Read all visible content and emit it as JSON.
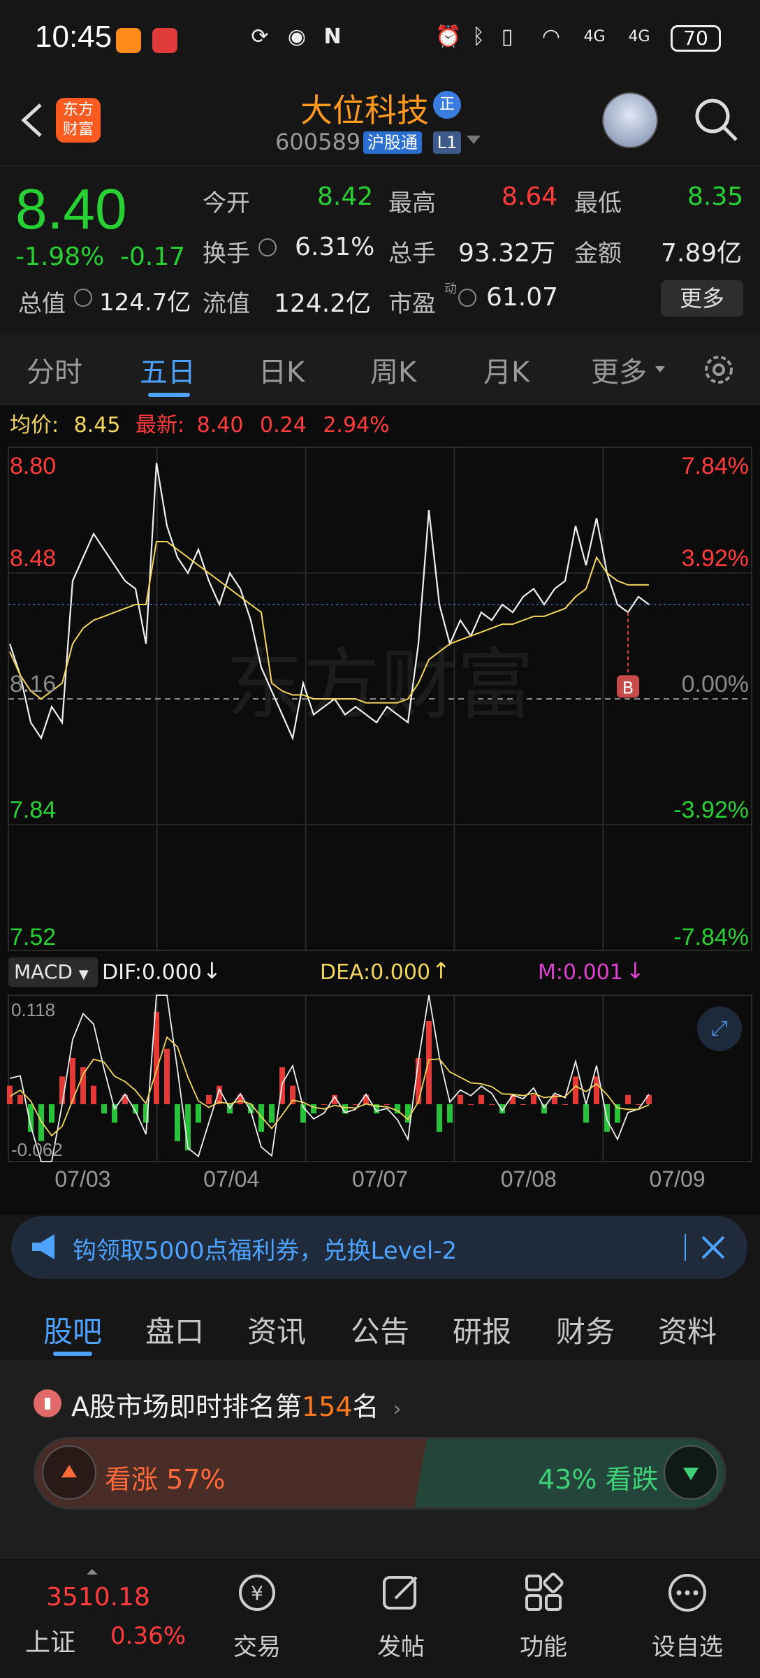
{
  "status": {
    "time": "10:45",
    "battery": "70",
    "net1": "4G",
    "net2": "4G"
  },
  "header": {
    "title": "大位科技",
    "title_badge": "正",
    "code": "600589",
    "market_badge": "沪股通",
    "level_badge": "L1",
    "logo_line1": "东方",
    "logo_line2": "财富"
  },
  "quote": {
    "price": "8.40",
    "change_pct": "-1.98%",
    "change": "-0.17",
    "open_label": "今开",
    "open": "8.42",
    "high_label": "最高",
    "high": "8.64",
    "low_label": "最低",
    "low": "8.35",
    "turnover_label": "换手",
    "turnover": "6.31%",
    "volume_label": "总手",
    "volume": "93.32万",
    "amount_label": "金额",
    "amount": "7.89亿",
    "mcap_label": "总值",
    "mcap": "124.7亿",
    "float_label": "流值",
    "float": "124.2亿",
    "pe_label": "市盈",
    "pe_sup": "动",
    "pe": "61.07",
    "more_button": "更多"
  },
  "tabs": [
    "分时",
    "五日",
    "日K",
    "周K",
    "月K",
    "更多"
  ],
  "active_tab": 1,
  "avg_line": {
    "avg_label": "均价:",
    "avg": "8.45",
    "last_label": "最新:",
    "last": "8.40",
    "chg": "0.24",
    "pct": "2.94%"
  },
  "chart_data": {
    "type": "line",
    "title": "",
    "x_labels": [
      "07/03",
      "07/04",
      "07/07",
      "07/08",
      "07/09"
    ],
    "y_left_ticks": [
      "8.80",
      "8.48",
      "8.16",
      "7.84",
      "7.52"
    ],
    "y_right_ticks": [
      "7.84%",
      "3.92%",
      "0.00%",
      "-3.92%",
      "-7.84%"
    ],
    "ylim": [
      7.52,
      8.8
    ],
    "prev_close": 8.16,
    "series": [
      {
        "values": [
          8.3,
          8.22,
          8.1,
          8.06,
          8.14,
          8.1,
          8.46,
          8.52,
          8.58,
          8.54,
          8.5,
          8.46,
          8.44,
          8.3,
          8.76,
          8.6,
          8.52,
          8.48,
          8.54,
          8.46,
          8.4,
          8.48,
          8.44,
          8.36,
          8.24,
          8.18,
          8.12,
          8.06,
          8.2,
          8.12,
          8.14,
          8.16,
          8.12,
          8.14,
          8.12,
          8.1,
          8.14,
          8.12,
          8.1,
          8.3,
          8.64,
          8.4,
          8.3,
          8.36,
          8.32,
          8.38,
          8.36,
          8.4,
          8.38,
          8.42,
          8.44,
          8.4,
          8.44,
          8.46,
          8.6,
          8.5,
          8.62,
          8.48,
          8.4,
          8.38,
          8.42,
          8.4
        ]
      },
      {
        "values": [
          8.28,
          8.22,
          8.18,
          8.16,
          8.18,
          8.2,
          8.3,
          8.34,
          8.36,
          8.37,
          8.38,
          8.39,
          8.4,
          8.4,
          8.56,
          8.56,
          8.54,
          8.52,
          8.5,
          8.48,
          8.46,
          8.44,
          8.42,
          8.4,
          8.38,
          8.2,
          8.18,
          8.17,
          8.17,
          8.16,
          8.16,
          8.16,
          8.16,
          8.16,
          8.15,
          8.15,
          8.15,
          8.15,
          8.16,
          8.2,
          8.26,
          8.28,
          8.3,
          8.31,
          8.32,
          8.33,
          8.34,
          8.35,
          8.35,
          8.36,
          8.37,
          8.37,
          8.38,
          8.39,
          8.42,
          8.44,
          8.52,
          8.48,
          8.46,
          8.45,
          8.45,
          8.45
        ]
      }
    ],
    "marker": "B"
  },
  "macd": {
    "name": "MACD",
    "dif": "DIF:0.000",
    "dea": "DEA:0.000",
    "m": "M:0.001",
    "top": "0.118",
    "bottom": "-0.062",
    "hist": [
      0.02,
      0.01,
      -0.03,
      -0.04,
      -0.02,
      0.03,
      0.05,
      0.04,
      0.02,
      -0.01,
      -0.02,
      0.01,
      -0.01,
      -0.02,
      0.1,
      0.06,
      -0.04,
      -0.05,
      -0.02,
      0.01,
      0.02,
      -0.01,
      0.01,
      -0.01,
      -0.03,
      -0.02,
      0.04,
      0.02,
      -0.02,
      -0.01,
      0.0,
      0.01,
      -0.01,
      0.0,
      0.01,
      -0.01,
      0.0,
      -0.01,
      -0.02,
      0.05,
      0.09,
      -0.03,
      -0.02,
      0.01,
      0.0,
      0.01,
      0.0,
      -0.01,
      0.01,
      0.0,
      0.01,
      -0.01,
      0.01,
      0.0,
      0.03,
      -0.02,
      0.03,
      -0.03,
      -0.02,
      0.01,
      0.0,
      0.01
    ]
  },
  "banner": {
    "text": "钩领取5000点福利券，兑换Level-2"
  },
  "subtabs": [
    "股吧",
    "盘口",
    "资讯",
    "公告",
    "研报",
    "财务",
    "资料"
  ],
  "active_subtab": 0,
  "rank": {
    "prefix": "A股市场即时排名第",
    "num": "154",
    "suffix": "名",
    "up_label": "看涨 57%",
    "down_label": "43% 看跌",
    "up_frac": 0.57
  },
  "bottom_nav": {
    "index_value": "3510.18",
    "index_name": "上证",
    "index_pct": "0.36%",
    "trade": "交易",
    "post": "发帖",
    "func": "功能",
    "watch": "设自选"
  },
  "colors": {
    "up": "#ff3b3b",
    "down": "#27d133",
    "accent": "#4da3ff",
    "title": "#ff9a1f",
    "avg": "#f2d75a"
  }
}
